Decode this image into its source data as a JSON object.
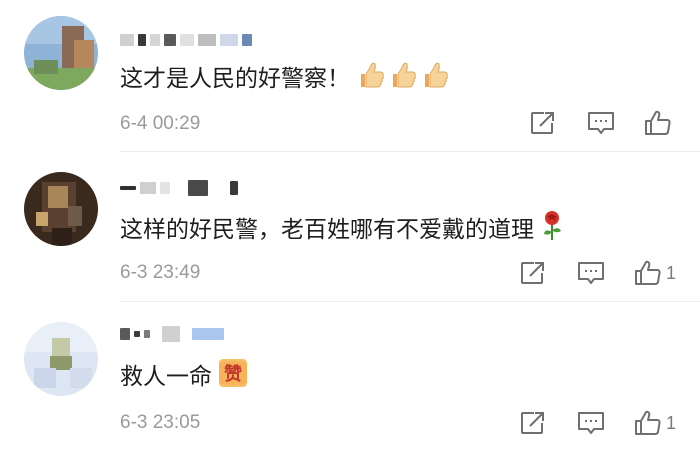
{
  "comments": [
    {
      "text": "这才是人民的好警察！",
      "time": "6-4 00:29",
      "like_count": "",
      "emoji": "thumbs-up-icon x3"
    },
    {
      "text": "这样的好民警，老百姓哪有不爱戴的道理",
      "time": "6-3 23:49",
      "like_count": "1",
      "emoji": "rose-icon"
    },
    {
      "text": "救人一命",
      "time": "6-3 23:05",
      "like_count": "1",
      "emoji": "zan-sticker-icon"
    }
  ],
  "zan_sticker_text": "赞",
  "colors": {
    "meta_text": "#9a9a9a",
    "divider": "#ececec",
    "icon": "#6f6f6f"
  }
}
